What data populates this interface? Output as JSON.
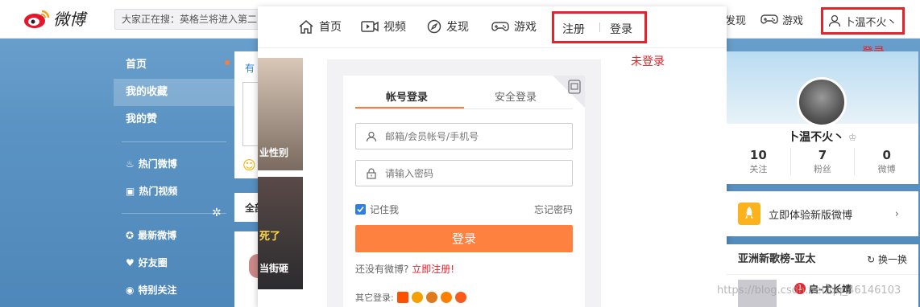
{
  "topbar": {
    "logo_text": "微博",
    "search_placeholder": "大家正在搜：英格兰将进入第二",
    "discover_label": "发现",
    "game_label": "游戏",
    "user_name": "卜温不火丶"
  },
  "annotations": {
    "logged_in": "登录",
    "not_logged_in": "未登录"
  },
  "leftnav": {
    "items": [
      {
        "label": "首页"
      },
      {
        "label": "我的收藏"
      },
      {
        "label": "我的赞"
      }
    ],
    "subitems": [
      {
        "label": "热门微博",
        "icon": "fire-icon"
      },
      {
        "label": "热门视频",
        "icon": "video-icon"
      },
      {
        "label": "最新微博",
        "icon": "star-icon"
      },
      {
        "label": "好友圈",
        "icon": "heart-icon"
      },
      {
        "label": "特别关注",
        "icon": "target-icon"
      }
    ]
  },
  "feed": {
    "tab_fragment": "有",
    "all_fragment": "全部",
    "media_captions": [
      "业性别",
      "死了",
      "当街砸"
    ]
  },
  "panel": {
    "nav": [
      {
        "label": "首页",
        "icon": "home-icon"
      },
      {
        "label": "视频",
        "icon": "video-icon"
      },
      {
        "label": "发现",
        "icon": "compass-icon"
      },
      {
        "label": "游戏",
        "icon": "gamepad-icon"
      }
    ],
    "register_label": "注册",
    "login_label": "登录",
    "login_form": {
      "tab_account": "帐号登录",
      "tab_secure": "安全登录",
      "username_placeholder": "邮箱/会员帐号/手机号",
      "password_placeholder": "请输入密码",
      "remember_label": "记住我",
      "forgot_label": "忘记密码",
      "submit_label": "登录",
      "no_account_text": "还没有微博?",
      "register_now_label": "立即注册!",
      "other_login_label": "其它登录:"
    }
  },
  "profile": {
    "name": "卜温不火丶",
    "stats": [
      {
        "value": "10",
        "label": "关注"
      },
      {
        "value": "7",
        "label": "粉丝"
      },
      {
        "value": "0",
        "label": "微博"
      }
    ],
    "new_version_label": "立即体验新版微博",
    "chart_title": "亚洲新歌榜-亚太",
    "swap_label": "换一换",
    "chart_item": "启-尤长靖",
    "chart_rank": "1"
  },
  "watermark": "https://blog.csdn.net/qq_46146103",
  "colors": {
    "accent_orange": "#ff8140",
    "annotation_red": "#e6222a",
    "brand_blue_bg": "#5b94c4"
  }
}
